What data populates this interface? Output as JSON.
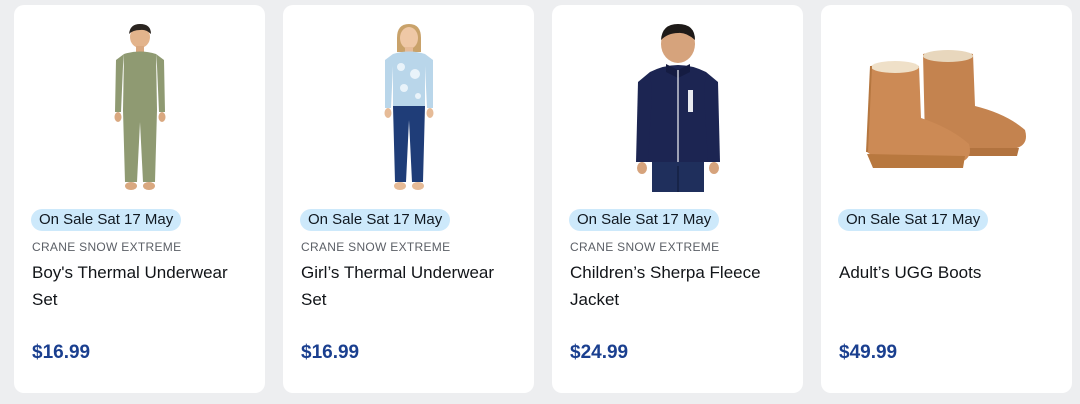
{
  "products": [
    {
      "badge": "On Sale Sat 17 May",
      "brand": "CRANE SNOW EXTREME",
      "title": "Boy's Thermal Underwear Set",
      "price": "$16.99",
      "image_icon": "boy-thermal-underwear-image"
    },
    {
      "badge": "On Sale Sat 17 May",
      "brand": "CRANE SNOW EXTREME",
      "title": "Girl’s Thermal Underwear Set",
      "price": "$16.99",
      "image_icon": "girl-thermal-underwear-image"
    },
    {
      "badge": "On Sale Sat 17 May",
      "brand": "CRANE SNOW EXTREME",
      "title": "Children’s Sherpa Fleece Jacket",
      "price": "$24.99",
      "image_icon": "sherpa-fleece-jacket-image"
    },
    {
      "badge": "On Sale Sat 17 May",
      "brand": "",
      "title": "Adult’s UGG Boots",
      "price": "$49.99",
      "image_icon": "ugg-boots-image"
    }
  ],
  "colors": {
    "badge_bg": "#cde9fb",
    "price": "#1a3f8f",
    "page_bg": "#edeef0"
  }
}
